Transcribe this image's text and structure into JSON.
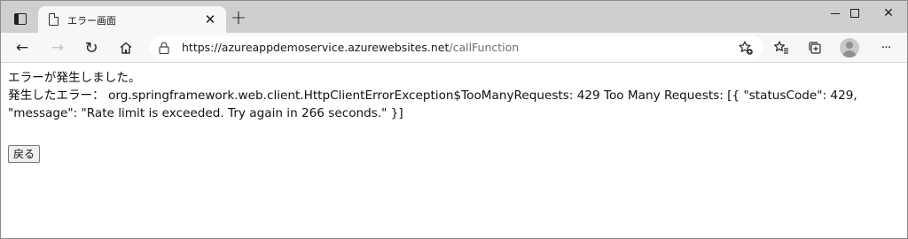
{
  "browser": {
    "tab": {
      "title": "エラー画面",
      "close_symbol": "✕"
    },
    "new_tab_symbol": "+",
    "window_controls": {
      "minimize": "minimize",
      "maximize": "maximize",
      "close_symbol": "✕"
    },
    "toolbar": {
      "back_symbol": "←",
      "forward_symbol": "→",
      "refresh_symbol": "↻",
      "more_symbol": "···"
    },
    "address": {
      "host": "https://azureappdemoservice.azurewebsites.net",
      "path": "/callFunction"
    },
    "icons": [
      "tab-actions-icon",
      "page-icon",
      "lock-icon",
      "favorite-add-icon",
      "favorites-icon",
      "collections-icon",
      "profile-avatar-icon"
    ]
  },
  "page": {
    "heading": "エラーが発生しました。",
    "error_line1": "発生したエラー： org.springframework.web.client.HttpClientErrorException$TooManyRequests: 429 Too Many Requests: [{ \"statusCode\": 429,",
    "error_line2": "\"message\": \"Rate limit is exceeded. Try again in 266 seconds.\" }]",
    "back_button_label": "戻る"
  }
}
